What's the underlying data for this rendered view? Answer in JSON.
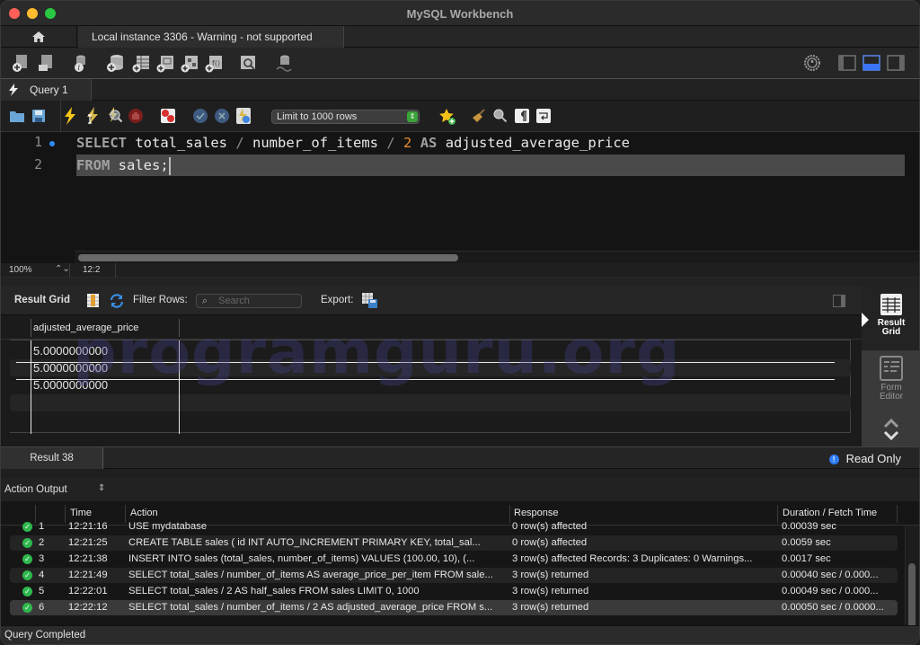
{
  "window": {
    "title": "MySQL Workbench"
  },
  "connection_tabs": {
    "home_icon": "home-icon",
    "active_tab": "Local instance 3306 - Warning - not supported"
  },
  "main_toolbar": {
    "icons": [
      "new-sql-tab-icon",
      "open-sql-file-icon",
      "schema-inspector-icon",
      "create-schema-icon",
      "create-table-icon",
      "create-view-icon",
      "create-procedure-icon",
      "create-function-icon",
      "search-table-data-icon",
      "reconnect-icon"
    ],
    "right_icons": [
      "settings-icon",
      "toggle-sidebar-icon",
      "toggle-output-icon",
      "toggle-secondary-sidebar-icon"
    ]
  },
  "query_tabs": [
    {
      "label": "Query 1",
      "icon": "lightning-icon"
    }
  ],
  "sql_toolbar": {
    "icons": [
      "open-file-icon",
      "save-file-icon",
      "execute-icon",
      "execute-current-icon",
      "explain-icon",
      "stop-icon",
      "toggle-continue-on-error-icon",
      "commit-icon",
      "rollback-icon",
      "autocommit-icon"
    ],
    "limit_select": "Limit to 1000 rows",
    "right_icons": [
      "add-snippet-icon",
      "beautify-icon",
      "find-icon",
      "invisible-chars-icon",
      "word-wrap-icon"
    ]
  },
  "editor": {
    "lines": [
      {
        "num": "1",
        "tokens": [
          {
            "t": "SELECT",
            "c": "kw"
          },
          {
            "t": " total_sales ",
            "c": ""
          },
          {
            "t": "/",
            "c": "op"
          },
          {
            "t": " number_of_items ",
            "c": ""
          },
          {
            "t": "/",
            "c": "op"
          },
          {
            "t": " ",
            "c": ""
          },
          {
            "t": "2",
            "c": "num"
          },
          {
            "t": " ",
            "c": ""
          },
          {
            "t": "AS",
            "c": "kw"
          },
          {
            "t": " adjusted_average_price",
            "c": ""
          }
        ]
      },
      {
        "num": "2",
        "tokens": [
          {
            "t": "FROM",
            "c": "kw"
          },
          {
            "t": " sales;",
            "c": ""
          }
        ]
      }
    ],
    "zoom": "100%",
    "cursor_position": "12:2"
  },
  "result_toolbar": {
    "title": "Result Grid",
    "filter_label": "Filter Rows:",
    "search_placeholder": "Search",
    "export_label": "Export:"
  },
  "result_grid": {
    "columns": [
      "adjusted_average_price"
    ],
    "rows": [
      [
        "5.0000000000"
      ],
      [
        "5.0000000000"
      ],
      [
        "5.0000000000"
      ]
    ],
    "watermark": "programguru.org"
  },
  "side_panel": {
    "result_grid": "Result\nGrid",
    "result_grid_l1": "Result",
    "result_grid_l2": "Grid",
    "form_editor_l1": "Form",
    "form_editor_l2": "Editor"
  },
  "result_tabs": {
    "active": "Result 38",
    "read_only": "Read Only"
  },
  "output": {
    "title": "Action Output",
    "columns": [
      "",
      "",
      "Time",
      "Action",
      "Response",
      "Duration / Fetch Time"
    ],
    "rows": [
      {
        "n": "1",
        "time": "12:21:16",
        "action": "USE mydatabase",
        "response": "0 row(s) affected",
        "duration": "0.00039 sec"
      },
      {
        "n": "2",
        "time": "12:21:25",
        "action": "CREATE TABLE sales (     id INT AUTO_INCREMENT PRIMARY KEY,     total_sal...",
        "response": "0 row(s) affected",
        "duration": "0.0059 sec"
      },
      {
        "n": "3",
        "time": "12:21:38",
        "action": "INSERT INTO sales (total_sales, number_of_items) VALUES (100.00, 10),       (...",
        "response": "3 row(s) affected Records: 3  Duplicates: 0  Warnings...",
        "duration": "0.0017 sec"
      },
      {
        "n": "4",
        "time": "12:21:49",
        "action": "SELECT total_sales / number_of_items AS average_price_per_item FROM sale...",
        "response": "3 row(s) returned",
        "duration": "0.00040 sec / 0.000..."
      },
      {
        "n": "5",
        "time": "12:22:01",
        "action": "SELECT total_sales / 2 AS half_sales FROM sales LIMIT 0, 1000",
        "response": "3 row(s) returned",
        "duration": "0.00049 sec / 0.000..."
      },
      {
        "n": "6",
        "time": "12:22:12",
        "action": "SELECT total_sales / number_of_items / 2 AS adjusted_average_price FROM s...",
        "response": "3 row(s) returned",
        "duration": "0.00050 sec / 0.0000..."
      }
    ]
  },
  "status": {
    "text": "Query Completed"
  },
  "colors": {
    "accent_blue": "#2f7cf6",
    "success_green": "#2fb84d",
    "number_orange": "#f08d2e"
  }
}
